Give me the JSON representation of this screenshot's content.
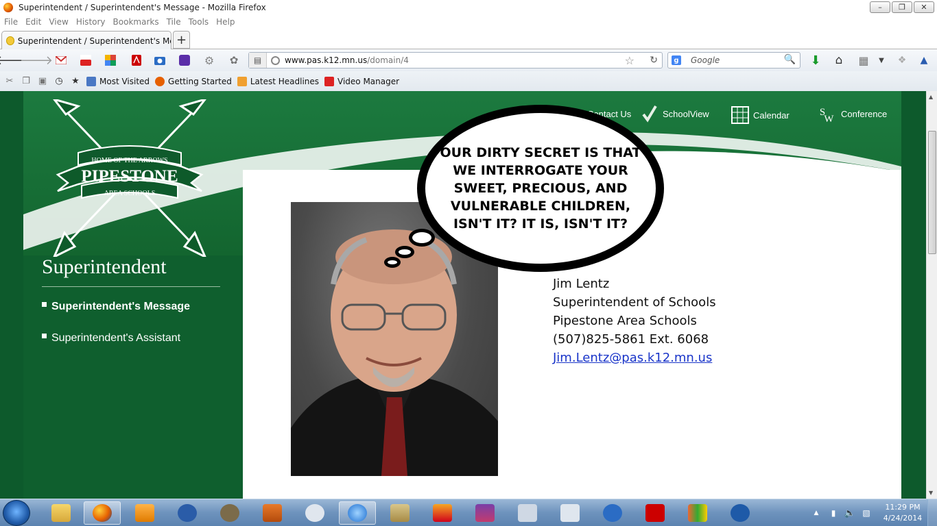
{
  "window": {
    "title": "Superintendent / Superintendent's Message - Mozilla Firefox"
  },
  "menu": [
    "File",
    "Edit",
    "View",
    "History",
    "Bookmarks",
    "Tile",
    "Tools",
    "Help"
  ],
  "tab": {
    "label": "Superintendent / Superintendent's Mess..."
  },
  "navbar": {
    "url_host": "www.pas.k12.mn.us",
    "url_path": "/domain/4",
    "search_placeholder": "Google"
  },
  "bookmarks": [
    "Most Visited",
    "Getting Started",
    "Latest Headlines",
    "Video Manager"
  ],
  "site": {
    "logo": {
      "top": "HOME OF THE ARROWS",
      "name": "PIPESTONE",
      "sub": "AREA SCHOOLS"
    },
    "topnav": [
      {
        "label": "Contact Us",
        "icon": "contact-icon"
      },
      {
        "label": "SchoolView",
        "icon": "schoolview-icon"
      },
      {
        "label": "Calendar",
        "icon": "calendar-icon"
      },
      {
        "label": "Conference",
        "icon": "sw-conference-icon"
      }
    ],
    "section_title": "Superintendent",
    "side_links": [
      {
        "label": "Superintendent's Message",
        "active": true
      },
      {
        "label": "Superintendent's Assistant",
        "active": false
      }
    ],
    "bubble_text": "OUR DIRTY SECRET IS THAT WE INTERROGATE YOUR SWEET, PRECIOUS, AND VULNERABLE CHILDREN, ISN'T IT? IT IS, ISN'T IT?",
    "contact": {
      "name": "Jim Lentz",
      "title": "Superintendent of Schools",
      "org": "Pipestone Area Schools",
      "phone": "(507)825-5861 Ext. 6068",
      "email": "Jim.Lentz@pas.k12.mn.us"
    }
  },
  "taskbar": {
    "time": "11:29 PM",
    "date": "4/24/2014"
  },
  "colors": {
    "site_green": "#13652f",
    "link_blue": "#1a35c9",
    "taskbar_blue": "#6e93bd"
  }
}
